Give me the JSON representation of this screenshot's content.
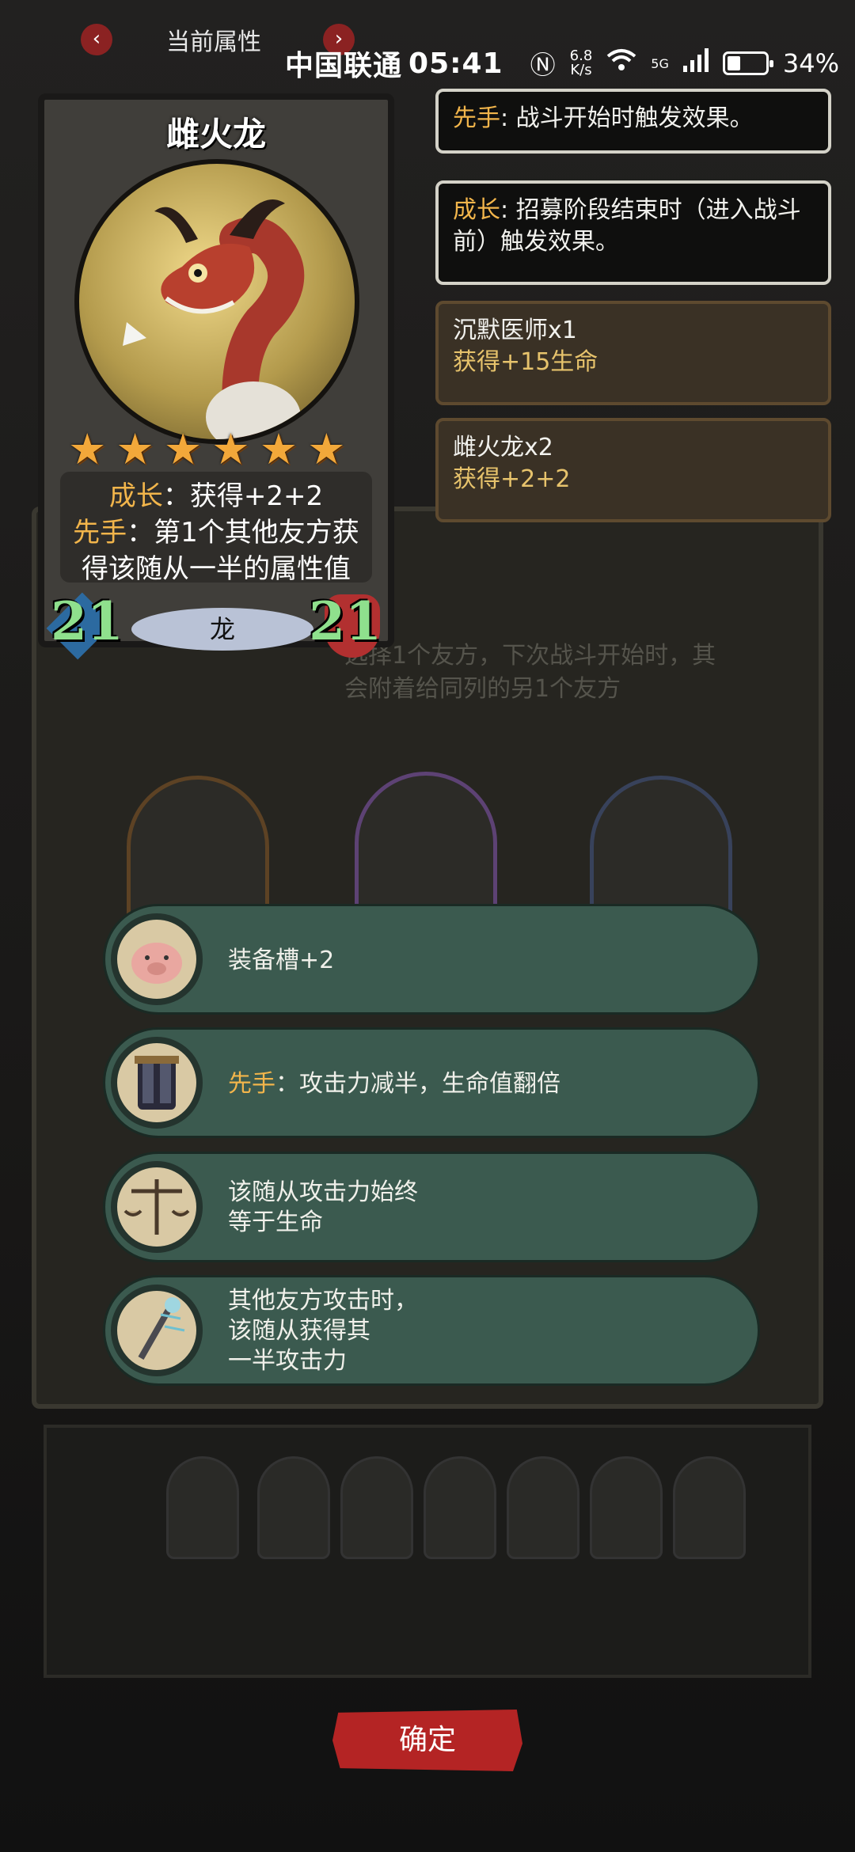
{
  "status_bar": {
    "carrier": "中国联通",
    "time": "05:41",
    "speed_value": "6.8",
    "speed_unit": "K/s",
    "signal": "5G",
    "battery_percent": "34%",
    "battery_level": 0.34
  },
  "header": {
    "title": "当前属性",
    "prev_label": "‹",
    "next_label": "›"
  },
  "card": {
    "name": "雌火龙",
    "stars": 6,
    "desc_line1_key": "成长",
    "desc_line1_text": "：获得+2+2",
    "desc_line2_key": "先手",
    "desc_line2_text": "：第1个其他友方获",
    "desc_line3": "得该随从一半的属性值",
    "attack": "21",
    "health": "21",
    "tribe": "龙"
  },
  "keywords": [
    {
      "key": "先手",
      "text": ": 战斗开始时触发效果。"
    },
    {
      "key": "成长",
      "text": ": 招募阶段结束时（进入战斗",
      "text2": "前）触发效果。"
    }
  ],
  "buffs": [
    {
      "source": "沉默医师x1",
      "effect": "获得+15生命"
    },
    {
      "source": "雌火龙x2",
      "effect": "获得+2+2"
    }
  ],
  "board_hint": {
    "line1": "选择1个友方，下次战斗开始时，其",
    "line2": "会附着给同列的另1个友方"
  },
  "equipment": [
    {
      "icon": "pig-icon",
      "text": "装备槽+2"
    },
    {
      "icon": "armor-icon",
      "key": "先手",
      "text": "：攻击力减半，生命值翻倍"
    },
    {
      "icon": "scale-icon",
      "line1": "该随从攻击力始终",
      "line2": "等于生命"
    },
    {
      "icon": "staff-icon",
      "line1": "其他友方攻击时，",
      "line2": "该随从获得其",
      "line3": "一半攻击力"
    }
  ],
  "confirm_label": "确定",
  "colors": {
    "accent_orange": "#f2b54b",
    "equip_bg": "#3b5a4f",
    "confirm_red": "#b42424",
    "stat_green": "#8fe08d"
  }
}
